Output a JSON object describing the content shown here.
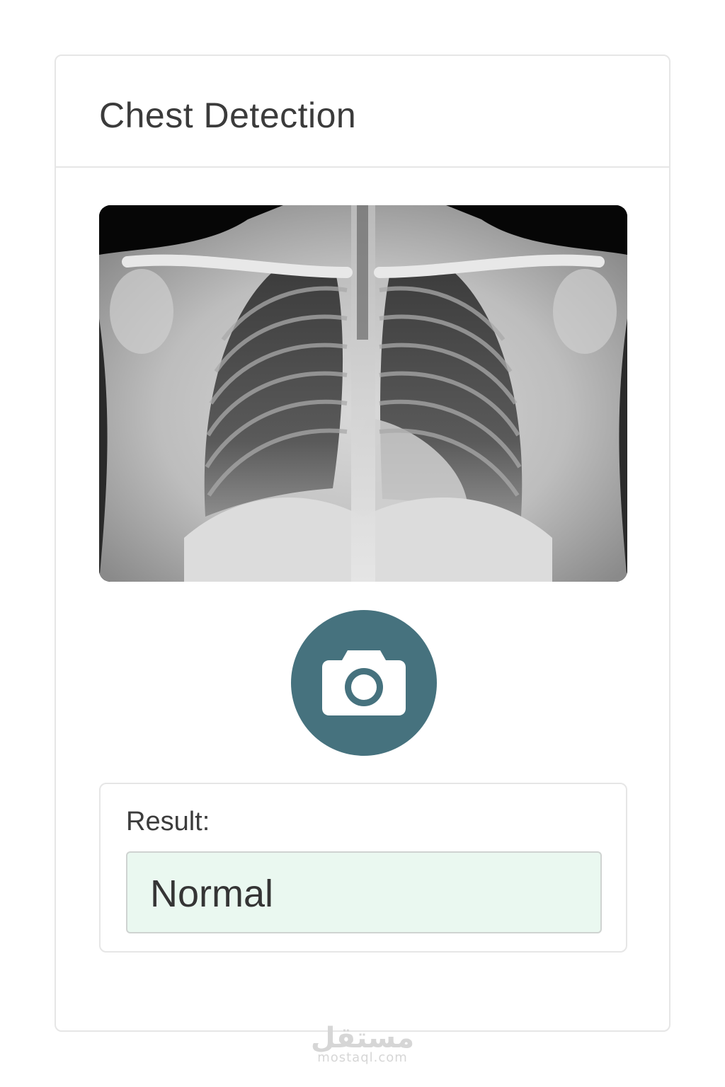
{
  "header": {
    "title": "Chest Detection"
  },
  "image": {
    "alt": "Chest X-ray"
  },
  "capture": {
    "icon": "camera-icon",
    "color": "#46727e"
  },
  "result": {
    "label": "Result:",
    "value": "Normal",
    "field_color": "#eaf8f0"
  },
  "watermark": {
    "logo": "مستقل",
    "url": "mostaql.com"
  }
}
